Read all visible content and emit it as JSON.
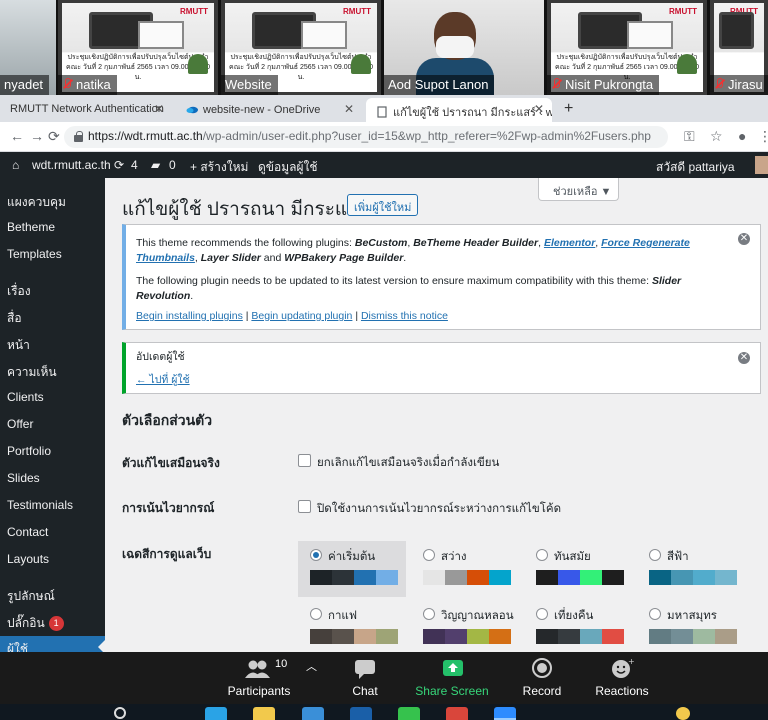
{
  "zoom": {
    "participants": [
      {
        "name": "nyadet",
        "muted": false
      },
      {
        "name": "natika",
        "muted": true
      },
      {
        "name": "Website",
        "muted": false
      },
      {
        "name": "Aod Supot Lanon",
        "muted": false
      },
      {
        "name": "Nisit Pukrongta",
        "muted": true
      },
      {
        "name": "Jirasu",
        "muted": true
      }
    ],
    "slide_caption": "ประชุมเชิงปฏิบัติการเพื่อปรับปรุงเว็บไซต์ประจำคณะ วันที่ 2 กุมภาพันธ์ 2565 เวลา 09.00–16.00 น.",
    "slide_logo": "RMUTT",
    "toolbar": {
      "participants_label": "Participants",
      "participants_count": "10",
      "chat_label": "Chat",
      "share_label": "Share Screen",
      "record_label": "Record",
      "reactions_label": "Reactions"
    }
  },
  "browser": {
    "tabs": [
      {
        "title": "RMUTT Network Authentication",
        "active": false
      },
      {
        "title": "website-new - OneDrive",
        "active": false
      },
      {
        "title": "แก้ไขผู้ใช้ ปรารถนา มีกระแสร์ ‹ wdt",
        "active": true
      }
    ],
    "new_tab_glyph": "+",
    "url_host": "https://wdt.rmutt.ac.th",
    "url_rest": "/wp-admin/user-edit.php?user_id=15&wp_http_referer=%2Fwp-admin%2Fusers.php"
  },
  "adminbar": {
    "site": "wdt.rmutt.ac.th",
    "updates": "4",
    "comments": "0",
    "new": "+ สร้างใหม่",
    "edit_user": "ดูข้อมูลผู้ใช้",
    "greeting": "สวัสดี pattariya"
  },
  "sidebar": {
    "items": [
      {
        "label": "แผงควบคุม"
      },
      {
        "label": "Betheme"
      },
      {
        "label": "Templates"
      },
      {
        "label": "เรื่อง"
      },
      {
        "label": "สื่อ"
      },
      {
        "label": "หน้า"
      },
      {
        "label": "ความเห็น"
      },
      {
        "label": "Clients"
      },
      {
        "label": "Offer"
      },
      {
        "label": "Portfolio"
      },
      {
        "label": "Slides"
      },
      {
        "label": "Testimonials"
      },
      {
        "label": "Contact"
      },
      {
        "label": "Layouts"
      },
      {
        "label": "รูปลักษณ์"
      },
      {
        "label": "ปลั๊กอิน",
        "badge": "1"
      },
      {
        "label": "ผู้ใช้"
      }
    ]
  },
  "content": {
    "help": "ช่วยเหลือ ▼",
    "title": "แก้ไขผู้ใช้ ปรารถนา มีกระแสร์",
    "add_new": "เพิ่มผู้ใช้ใหม่",
    "theme_notice": {
      "line1_prefix": "This theme recommends the following plugins: ",
      "plugin1": "BeCustom",
      "sep1": ", ",
      "plugin2": "BeTheme Header Builder",
      "sep2": ", ",
      "plugin3": "Elementor",
      "sep3": ", ",
      "plugin4": "Force Regenerate Thumbnails",
      "sep4": ", ",
      "plugin5": "Layer Slider",
      "and": " and ",
      "plugin6": "WPBakery Page Builder",
      "end": ".",
      "line2_prefix": "The following plugin needs to be updated to its latest version to ensure maximum compatibility with this theme: ",
      "plugin7": "Slider Revolution",
      "line2_end": ".",
      "link1": "Begin installing plugins",
      "link2": "Begin updating plugin",
      "link3": "Dismiss this notice",
      "divider": " | "
    },
    "updated_notice": {
      "text": "อัปเดตผู้ใช้",
      "back_link": "← ไปที่ ผู้ใช้"
    },
    "section_title": "ตัวเลือกส่วนตัว",
    "visual_editor_label": "ตัวแก้ไขเสมือนจริง",
    "visual_editor_option": "ยกเลิกแก้ไขเสมือนจริงเมื่อกำลังเขียน",
    "syntax_label": "การเน้นไวยากรณ์",
    "syntax_option": "ปิดใช้งานการเน้นไวยากรณ์ระหว่างการแก้ไขโค้ด",
    "scheme_label": "เฉดสีการดูแลเว็บ",
    "schemes": [
      {
        "name": "ค่าเริ่มต้น",
        "selected": true,
        "colors": [
          "#1d2327",
          "#2c3338",
          "#2271b1",
          "#72aee6"
        ]
      },
      {
        "name": "สว่าง",
        "selected": false,
        "colors": [
          "#e5e5e5",
          "#999999",
          "#d64e07",
          "#04a4cc"
        ]
      },
      {
        "name": "ทันสมัย",
        "selected": false,
        "colors": [
          "#1e1e1e",
          "#3858e9",
          "#33f078",
          "#1e1e1e"
        ]
      },
      {
        "name": "สีฟ้า",
        "selected": false,
        "colors": [
          "#096484",
          "#4796b3",
          "#52accc",
          "#74b6ce"
        ]
      },
      {
        "name": "กาแฟ",
        "selected": false,
        "colors": [
          "#46403c",
          "#59524c",
          "#c7a589",
          "#9ea476"
        ]
      },
      {
        "name": "วิญญาณหลอน",
        "selected": false,
        "colors": [
          "#413256",
          "#523f6d",
          "#a3b745",
          "#d46f15"
        ]
      },
      {
        "name": "เที่ยงคืน",
        "selected": false,
        "colors": [
          "#25282b",
          "#363b3f",
          "#69a8bb",
          "#e14d43"
        ]
      },
      {
        "name": "มหาสมุทร",
        "selected": false,
        "colors": [
          "#627c83",
          "#738e96",
          "#9ebaa0",
          "#aa9d88"
        ]
      }
    ]
  }
}
